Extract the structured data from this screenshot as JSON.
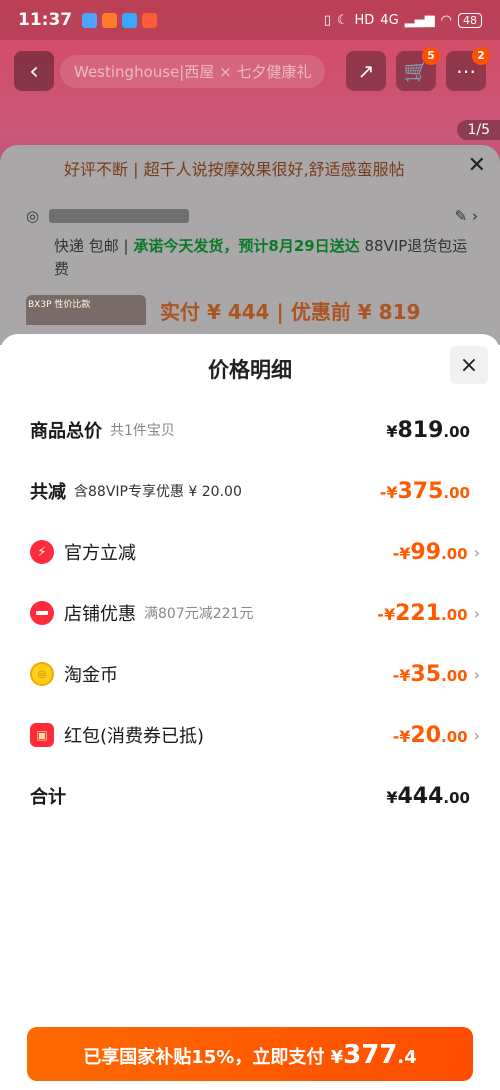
{
  "status": {
    "time": "11:37",
    "network": "4G",
    "battery": "48"
  },
  "background": {
    "nav_title": "Westinghouse|西屋 × 七夕健康礼",
    "cart_badge": "5",
    "more_badge": "2",
    "image_counter": "1/5",
    "review_banner": "好评不断 | 超千人说按摩效果很好,舒适感蛮服帖",
    "shipping_text_1": "快递 包邮 |",
    "shipping_promise": "承诺今天发货，预计8月29日送达",
    "shipping_text_2": "88VIP退货包运费",
    "thumb_tag": "BX3P 性价比款",
    "price_preview": "实付 ¥ 444 | 优惠前 ¥ 819"
  },
  "sheet": {
    "title": "价格明细",
    "close_icon": "×",
    "rows": {
      "total": {
        "label": "商品总价",
        "sub": "共1件宝贝",
        "symbol": "¥",
        "int": "819",
        "dec": ".00"
      },
      "reduction": {
        "label": "共减",
        "sub": "含88VIP专享优惠 ¥ 20.00",
        "symbol": "-¥",
        "int": "375",
        "dec": ".00"
      },
      "official": {
        "label": "官方立减",
        "symbol": "-¥",
        "int": "99",
        "dec": ".00"
      },
      "shop": {
        "label": "店铺优惠",
        "sub": "满807元减221元",
        "symbol": "-¥",
        "int": "221",
        "dec": ".00"
      },
      "coin": {
        "label": "淘金币",
        "symbol": "-¥",
        "int": "35",
        "dec": ".00"
      },
      "redpacket": {
        "label": "红包(消费券已抵)",
        "symbol": "-¥",
        "int": "20",
        "dec": ".00"
      },
      "sum": {
        "label": "合计",
        "symbol": "¥",
        "int": "444",
        "dec": ".00"
      }
    },
    "chevron": "›"
  },
  "pay_button": {
    "prefix": "已享国家补贴15%，立即支付 ¥",
    "int": "377",
    "dec": ".4"
  },
  "colors": {
    "accent_orange": "#ff5a00",
    "promise_green": "#0a7a2a",
    "icon_red": "#ff2a3c"
  }
}
